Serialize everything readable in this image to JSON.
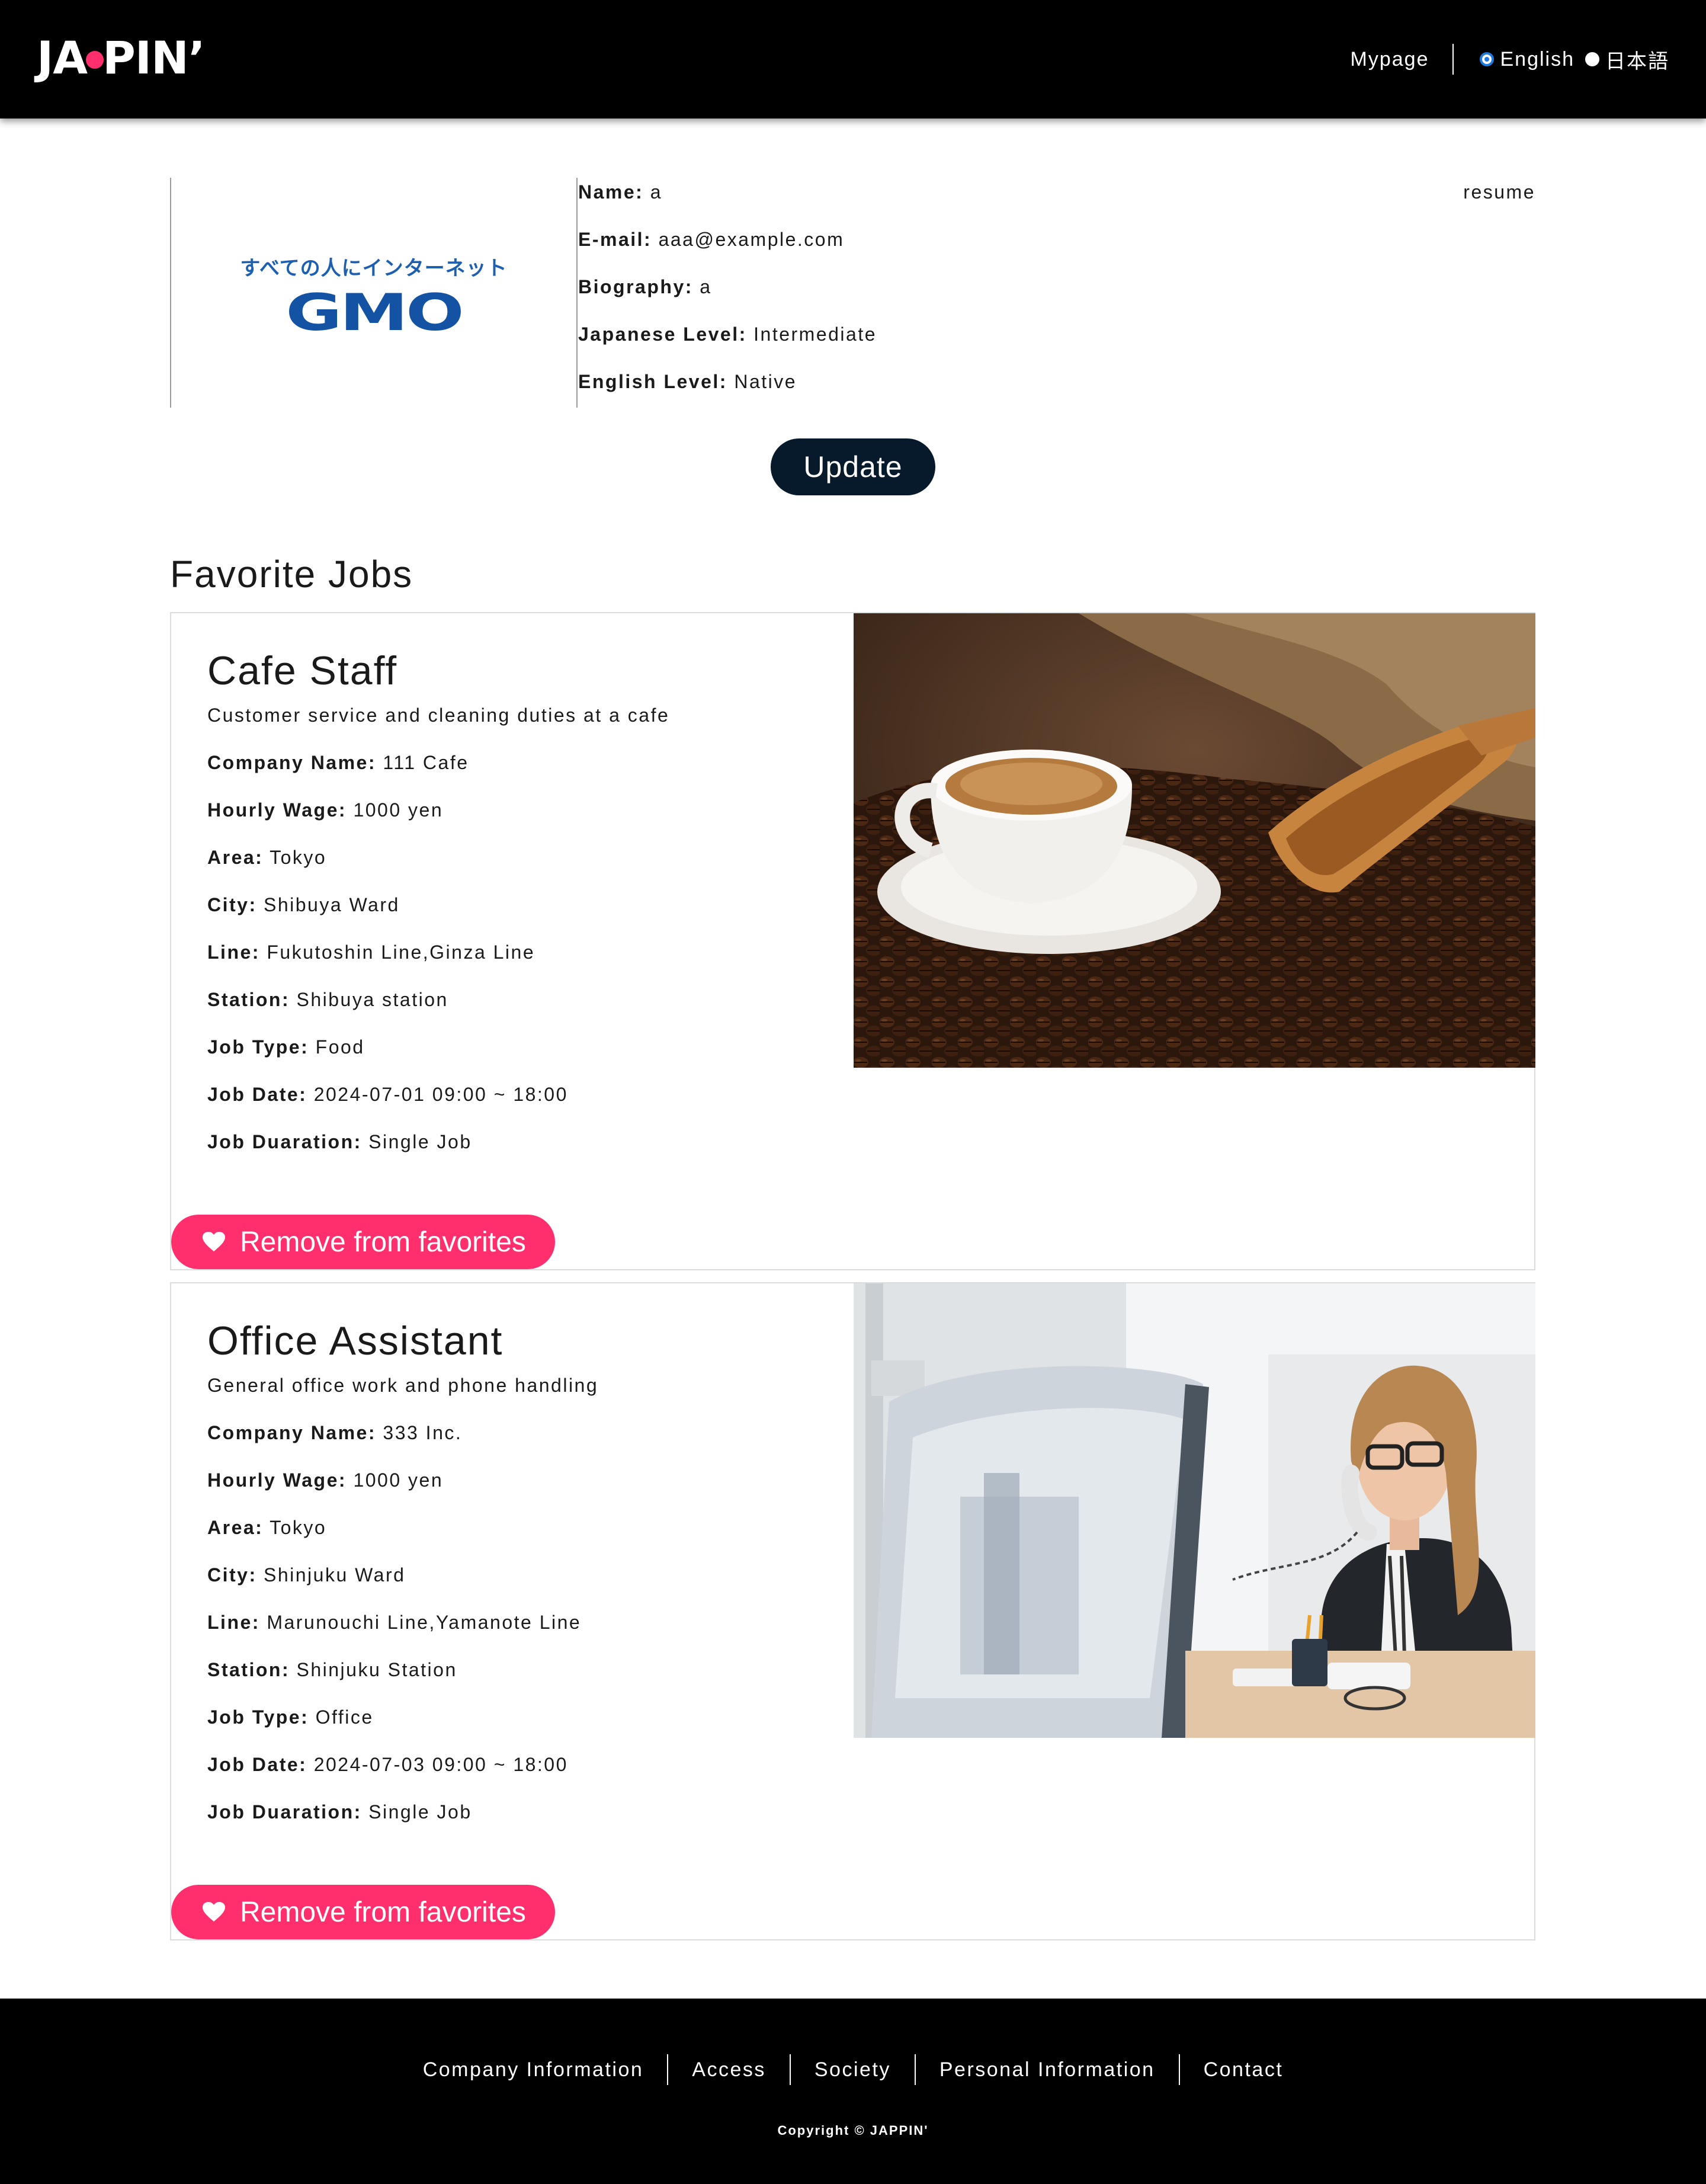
{
  "header": {
    "logo": "JAPPIN'",
    "mypage": "Mypage",
    "languages": [
      {
        "label": "English",
        "selected": true
      },
      {
        "label": "日本語",
        "selected": false
      }
    ]
  },
  "profile": {
    "company_logo": {
      "tagline": "すべての人にインターネット",
      "mark": "GMO"
    },
    "resume_link": "resume",
    "fields": [
      {
        "label": "Name:",
        "value": "a"
      },
      {
        "label": "E-mail:",
        "value": "aaa@example.com"
      },
      {
        "label": "Biography:",
        "value": "a"
      },
      {
        "label": "Japanese Level:",
        "value": "Intermediate"
      },
      {
        "label": "English Level:",
        "value": "Native"
      }
    ],
    "update_label": "Update"
  },
  "favorites": {
    "title": "Favorite Jobs",
    "remove_label": "Remove from favorites",
    "jobs": [
      {
        "title": "Cafe Staff",
        "description": "Customer service and cleaning duties at a cafe",
        "image": "coffee-cup-and-beans-photo",
        "fields": [
          {
            "label": "Company Name:",
            "value": "111 Cafe"
          },
          {
            "label": "Hourly Wage:",
            "value": "1000 yen"
          },
          {
            "label": "Area:",
            "value": "Tokyo"
          },
          {
            "label": "City:",
            "value": "Shibuya Ward"
          },
          {
            "label": "Line:",
            "value": "Fukutoshin Line,Ginza Line"
          },
          {
            "label": "Station:",
            "value": "Shibuya station"
          },
          {
            "label": "Job Type:",
            "value": "Food"
          },
          {
            "label": "Job Date:",
            "value": "2024-07-01 09:00 ~ 18:00"
          },
          {
            "label": "Job Duaration:",
            "value": "Single Job"
          }
        ]
      },
      {
        "title": "Office Assistant",
        "description": "General office work and phone handling",
        "image": "woman-on-office-phone-photo",
        "fields": [
          {
            "label": "Company Name:",
            "value": "333 Inc."
          },
          {
            "label": "Hourly Wage:",
            "value": "1000 yen"
          },
          {
            "label": "Area:",
            "value": "Tokyo"
          },
          {
            "label": "City:",
            "value": "Shinjuku Ward"
          },
          {
            "label": "Line:",
            "value": "Marunouchi Line,Yamanote Line"
          },
          {
            "label": "Station:",
            "value": "Shinjuku Station"
          },
          {
            "label": "Job Type:",
            "value": "Office"
          },
          {
            "label": "Job Date:",
            "value": "2024-07-03 09:00 ~ 18:00"
          },
          {
            "label": "Job Duaration:",
            "value": "Single Job"
          }
        ]
      }
    ]
  },
  "footer": {
    "links": [
      "Company Information",
      "Access",
      "Society",
      "Personal Information",
      "Contact"
    ],
    "copyright": "Copyright © JAPPIN'"
  },
  "colors": {
    "header_bg": "#000000",
    "accent_pink": "#ff2f6e",
    "update_button": "#061a2b",
    "gmo_blue": "#1453a3",
    "radio_selected": "#1f7ae0"
  }
}
